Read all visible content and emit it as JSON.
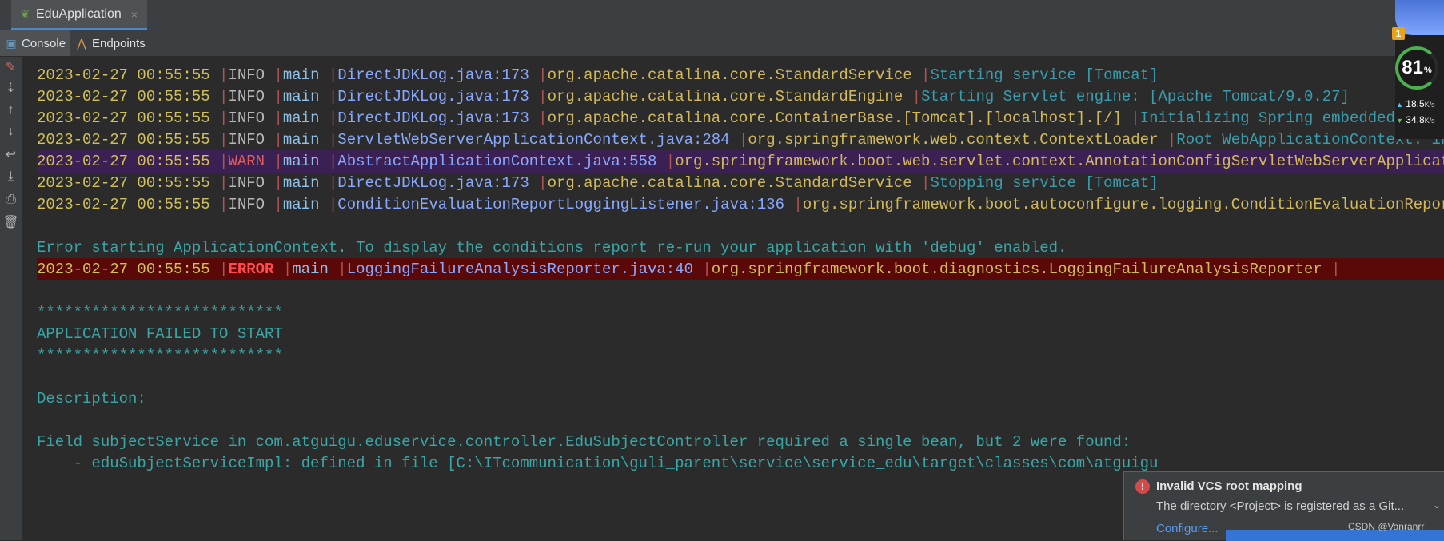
{
  "window": {
    "tab_title": "EduApplication",
    "close_glyph": "×"
  },
  "toolwindow": {
    "tabs": [
      {
        "label": "Console",
        "icon": "console-icon"
      },
      {
        "label": "Endpoints",
        "icon": "endpoints-icon"
      }
    ]
  },
  "gutter": {
    "buttons": [
      "rerun-icon",
      "scroll-to-end-icon",
      "up-arrow-icon",
      "down-arrow-icon",
      "soft-wrap-icon",
      "scroll-down-icon",
      "print-icon",
      "trash-icon"
    ]
  },
  "log": {
    "lines": [
      {
        "ts": "2023-02-27 00:55:55",
        "level": "INFO ",
        "thread": "main",
        "src": "DirectJDKLog.java:173",
        "logger": "org.apache.catalina.core.StandardService",
        "msg": "Starting service [Tomcat]"
      },
      {
        "ts": "2023-02-27 00:55:55",
        "level": "INFO ",
        "thread": "main",
        "src": "DirectJDKLog.java:173",
        "logger": "org.apache.catalina.core.StandardEngine",
        "msg": "Starting Servlet engine: [Apache Tomcat/9.0.27]"
      },
      {
        "ts": "2023-02-27 00:55:55",
        "level": "INFO ",
        "thread": "main",
        "src": "DirectJDKLog.java:173",
        "logger": "org.apache.catalina.core.ContainerBase.[Tomcat].[localhost].[/]",
        "msg": "Initializing Spring embedded Web"
      },
      {
        "ts": "2023-02-27 00:55:55",
        "level": "INFO ",
        "thread": "main",
        "src": "ServletWebServerApplicationContext.java:284",
        "logger": "org.springframework.web.context.ContextLoader",
        "msg": "Root WebApplicationContext: initia"
      },
      {
        "ts": "2023-02-27 00:55:55",
        "level": "WARN ",
        "thread": "main",
        "src": "AbstractApplicationContext.java:558",
        "logger": "org.springframework.boot.web.servlet.context.AnnotationConfigServletWebServerApplicationC",
        "msg": ""
      },
      {
        "ts": "2023-02-27 00:55:55",
        "level": "INFO ",
        "thread": "main",
        "src": "DirectJDKLog.java:173",
        "logger": "org.apache.catalina.core.StandardService",
        "msg": "Stopping service [Tomcat]"
      },
      {
        "ts": "2023-02-27 00:55:55",
        "level": "INFO ",
        "thread": "main",
        "src": "ConditionEvaluationReportLoggingListener.java:136",
        "logger": "org.springframework.boot.autoconfigure.logging.ConditionEvaluationReportLog",
        "msg": ""
      }
    ],
    "error_context_text": "Error starting ApplicationContext. To display the conditions report re-run your application with 'debug' enabled.",
    "error_line": {
      "ts": "2023-02-27 00:55:55",
      "level": "ERROR",
      "thread": "main",
      "src": "LoggingFailureAnalysisReporter.java:40",
      "logger": "org.springframework.boot.diagnostics.LoggingFailureAnalysisReporter",
      "msg": ""
    },
    "stars": "***************************",
    "failed_title": "APPLICATION FAILED TO START",
    "description_label": "Description:",
    "field_text": "Field subjectService in com.atguigu.eduservice.controller.EduSubjectController required a single bean, but 2 were found:",
    "bean_text": "    - eduSubjectServiceImpl: defined in file [C:\\ITcommunication\\guli_parent\\service\\service_edu\\target\\classes\\com\\atguigu"
  },
  "monitor": {
    "badge": "1",
    "percent": "81",
    "percent_unit": "%",
    "up_speed": "18.5",
    "down_speed": "34.8",
    "speed_unit": "K/s",
    "ring_color": "#4caf50"
  },
  "notification": {
    "title": "Invalid VCS root mapping",
    "body": "The directory <Project> is registered as a Git...",
    "link": "Configure...",
    "icon": "error-icon"
  },
  "watermark": "CSDN @Vanranrr"
}
